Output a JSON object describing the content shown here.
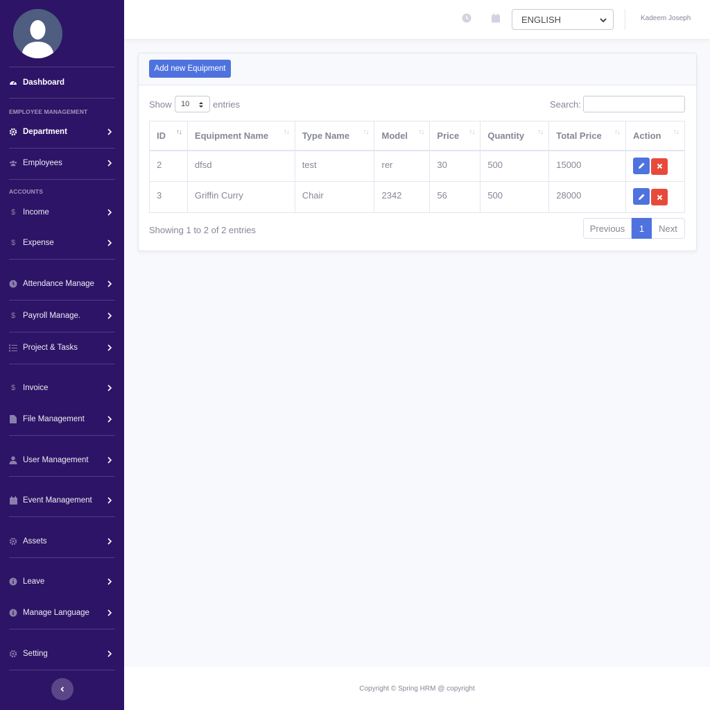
{
  "sidebar": {
    "dashboard": "Dashboard",
    "section_employee": "EMPLOYEE MANAGEMENT",
    "department": "Department",
    "employees": "Employees",
    "section_accounts": "ACCOUNTS",
    "income": "Income",
    "expense": "Expense",
    "attendance": "Attendance Manage",
    "payroll": "Payroll Manage.",
    "projects": "Project & Tasks",
    "invoice": "Invoice",
    "files": "File Management",
    "users": "User Management",
    "events": "Event Management",
    "assets": "Assets",
    "leave": "Leave",
    "language": "Manage Language",
    "setting": "Setting",
    "dollar_glyph": "$"
  },
  "topbar": {
    "language": "ENGLISH",
    "user": "Kadeem Joseph"
  },
  "card": {
    "add_button": "Add new Equipment",
    "show": "Show",
    "entries_value": "10",
    "entries": "entries",
    "search": "Search:",
    "columns": [
      "ID",
      "Equipment Name",
      "Type Name",
      "Model",
      "Price",
      "Quantity",
      "Total Price",
      "Action"
    ],
    "rows": [
      [
        "2",
        "dfsd",
        "test",
        "rer",
        "30",
        "500",
        "15000"
      ],
      [
        "3",
        "Griffin Curry",
        "Chair",
        "2342",
        "56",
        "500",
        "28000"
      ]
    ],
    "info": "Showing 1 to 2 of 2 entries",
    "prev": "Previous",
    "page": "1",
    "next": "Next",
    "sort_arrows": "↑↓"
  },
  "footer": "Copyright © Spring HRM @ copyright",
  "colors": {
    "sidebar": "#2d1466",
    "primary": "#4e73df",
    "danger": "#e74a3b"
  }
}
